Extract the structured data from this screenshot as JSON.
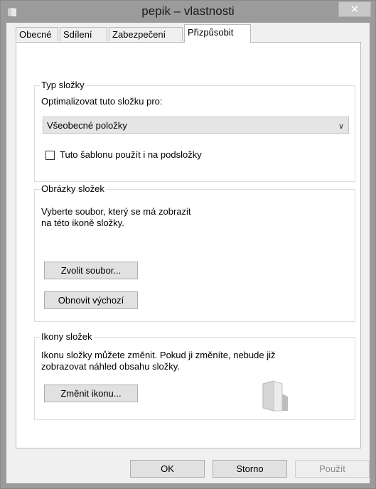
{
  "window": {
    "title": "pepik – vlastnosti",
    "close_symbol": "✕"
  },
  "tabs": [
    {
      "label": "Obecné"
    },
    {
      "label": "Sdílení"
    },
    {
      "label": "Zabezpečení"
    },
    {
      "label": "Přizpůsobit",
      "active": true
    }
  ],
  "folder_type": {
    "group_label": "Typ složky",
    "optimize_label": "Optimalizovat tuto složku pro:",
    "selected_option": "Všeobecné položky",
    "apply_subfolders_label": "Tuto šablonu použít i na podsložky",
    "apply_subfolders_checked": false
  },
  "folder_pictures": {
    "group_label": "Obrázky složek",
    "description_line1": "Vyberte soubor, který se má zobrazit",
    "description_line2": "na této ikoně složky.",
    "choose_file_button": "Zvolit soubor...",
    "restore_default_button": "Obnovit výchozí"
  },
  "folder_icons": {
    "group_label": "Ikony složek",
    "description_line1": "Ikonu složky můžete změnit. Pokud ji změníte, nebude již",
    "description_line2": "zobrazovat náhled obsahu složky.",
    "change_icon_button": "Změnit ikonu..."
  },
  "footer": {
    "ok": "OK",
    "cancel": "Storno",
    "apply": "Použít"
  }
}
